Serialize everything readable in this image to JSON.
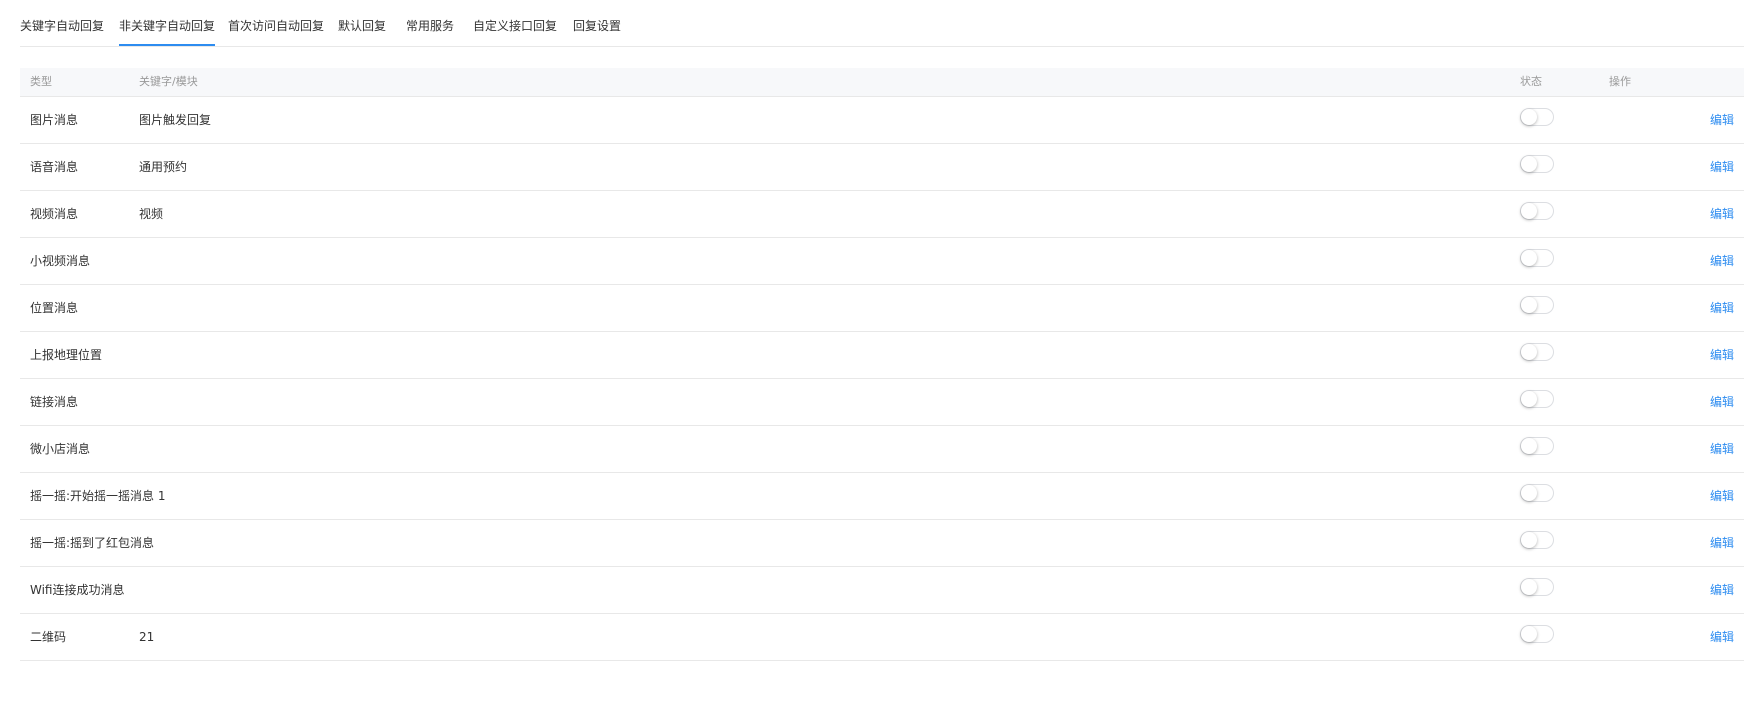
{
  "tabs": [
    {
      "label": "关键字自动回复",
      "active": false
    },
    {
      "label": "非关键字自动回复",
      "active": true
    },
    {
      "label": "首次访问自动回复",
      "active": false
    },
    {
      "label": "默认回复",
      "active": false
    },
    {
      "label": "常用服务",
      "active": false
    },
    {
      "label": "自定义接口回复",
      "active": false
    },
    {
      "label": "回复设置",
      "active": false
    }
  ],
  "table": {
    "headers": {
      "type": "类型",
      "keyword": "关键字/模块",
      "status": "状态",
      "operation": "操作"
    },
    "rows": [
      {
        "type": "图片消息",
        "keyword": "图片触发回复",
        "enabled": false,
        "action": "编辑"
      },
      {
        "type": "语音消息",
        "keyword": "通用预约",
        "enabled": false,
        "action": "编辑"
      },
      {
        "type": "视频消息",
        "keyword": "视频",
        "enabled": false,
        "action": "编辑"
      },
      {
        "type": "小视频消息",
        "keyword": "",
        "enabled": false,
        "action": "编辑"
      },
      {
        "type": "位置消息",
        "keyword": "",
        "enabled": false,
        "action": "编辑"
      },
      {
        "type": "上报地理位置",
        "keyword": "",
        "enabled": false,
        "action": "编辑"
      },
      {
        "type": "链接消息",
        "keyword": "",
        "enabled": false,
        "action": "编辑"
      },
      {
        "type": "微小店消息",
        "keyword": "",
        "enabled": false,
        "action": "编辑"
      },
      {
        "type": "摇一摇:开始摇一摇消息 1",
        "keyword": "",
        "enabled": false,
        "action": "编辑"
      },
      {
        "type": "摇一摇:摇到了红包消息",
        "keyword": "",
        "enabled": false,
        "action": "编辑"
      },
      {
        "type": "Wifi连接成功消息",
        "keyword": "",
        "enabled": false,
        "action": "编辑"
      },
      {
        "type": "二维码",
        "keyword": "21",
        "enabled": false,
        "action": "编辑"
      }
    ]
  },
  "colors": {
    "accent": "#2d8cf0",
    "border": "#e8e8e8",
    "header_bg": "#f7f8fa"
  }
}
